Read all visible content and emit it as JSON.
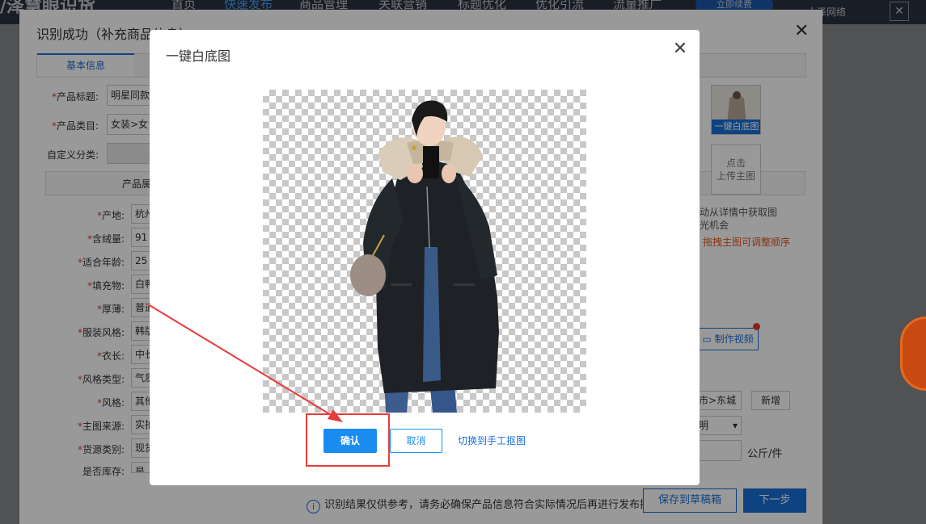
{
  "topnav": {
    "brand": "/泽慧眼识货",
    "items": [
      "首页",
      "快速发布",
      "商品管理",
      "关联营销",
      "标题优化",
      "优化引流",
      "流量推广"
    ],
    "active_index": 1,
    "renew_button": "立即续费",
    "user": "大泽网络"
  },
  "back_dialog": {
    "title": "识别成功（补充商品信息）",
    "close_label": "✕",
    "tab_basic": "基本信息",
    "fields": [
      {
        "label": "产品标题:",
        "required": true,
        "value": "明星同款"
      },
      {
        "label": "产品类目:",
        "required": true,
        "value": "女装>女"
      },
      {
        "label": "自定义分类:",
        "required": false,
        "value": ""
      }
    ],
    "attributes_header": "产品属",
    "attributes": [
      {
        "label": "产地:",
        "value": "杭州"
      },
      {
        "label": "含绒量:",
        "value": "91"
      },
      {
        "label": "适合年龄:",
        "value": "25"
      },
      {
        "label": "填充物:",
        "value": "白鸭"
      },
      {
        "label": "厚薄:",
        "value": "普通"
      },
      {
        "label": "服装风格:",
        "value": "韩版"
      },
      {
        "label": "衣长:",
        "value": "中长"
      },
      {
        "label": "风格类型:",
        "value": "气质"
      },
      {
        "label": "风格:",
        "value": "其他"
      },
      {
        "label": "主图来源:",
        "value": "实拍"
      },
      {
        "label": "货源类别:",
        "value": "现货"
      },
      {
        "label": "是否库存:",
        "value": "是"
      }
    ],
    "thumb_label": "一键白底图",
    "upload_label_1": "点击",
    "upload_label_2": "上传主图",
    "tip_1": "动从详情中获取图",
    "tip_2": "光机会",
    "tip_orange": "拖拽主图可调整顺序",
    "video_button": "制作视频",
    "region_select": "市>东城",
    "add_button": "新增",
    "unit": "公斤/件",
    "select_2": "明",
    "notice": "识别结果仅供参考，请务必确保产品信息符合实际情况后再进行发布操作",
    "info_icon": "i",
    "save_draft": "保存到草稿箱",
    "next": "下一步"
  },
  "modal": {
    "title": "一键白底图",
    "close_label": "✕",
    "confirm": "确认",
    "cancel": "取消",
    "manual_link": "切换到手工抠图"
  },
  "colors": {
    "accent": "#1a8cf0",
    "annotation": "#e83b3b"
  }
}
